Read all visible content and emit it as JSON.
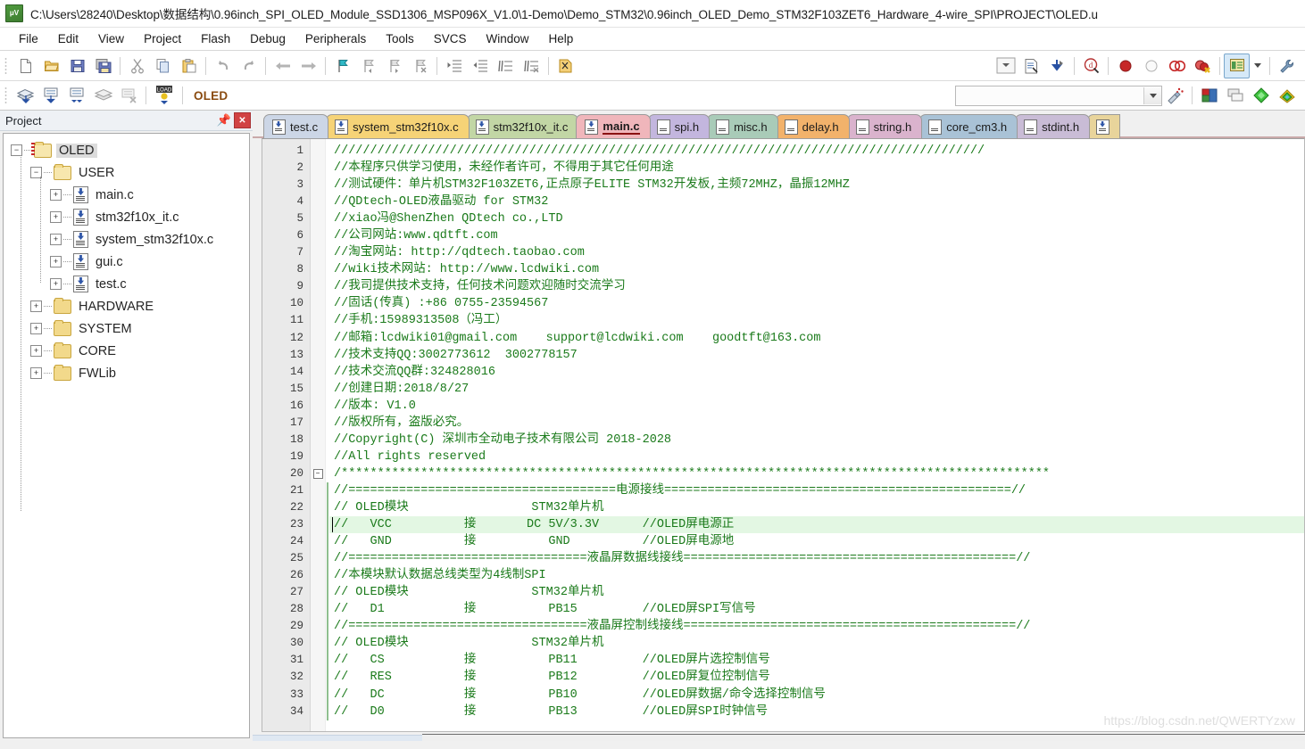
{
  "window": {
    "title": "C:\\Users\\28240\\Desktop\\数据结构\\0.96inch_SPI_OLED_Module_SSD1306_MSP096X_V1.0\\1-Demo\\Demo_STM32\\0.96inch_OLED_Demo_STM32F103ZET6_Hardware_4-wire_SPI\\PROJECT\\OLED.u",
    "app_icon": "uvision-icon",
    "app_icon_glyph": "μV"
  },
  "menubar": {
    "items": [
      {
        "label": "File",
        "name": "menu-file"
      },
      {
        "label": "Edit",
        "name": "menu-edit"
      },
      {
        "label": "View",
        "name": "menu-view"
      },
      {
        "label": "Project",
        "name": "menu-project"
      },
      {
        "label": "Flash",
        "name": "menu-flash"
      },
      {
        "label": "Debug",
        "name": "menu-debug"
      },
      {
        "label": "Peripherals",
        "name": "menu-peripherals"
      },
      {
        "label": "Tools",
        "name": "menu-tools"
      },
      {
        "label": "SVCS",
        "name": "menu-svcs"
      },
      {
        "label": "Window",
        "name": "menu-window"
      },
      {
        "label": "Help",
        "name": "menu-help"
      }
    ]
  },
  "toolbar_main": {
    "groups": [
      [
        "new-file-icon",
        "open-file-icon",
        "save-icon",
        "save-all-icon"
      ],
      [
        "cut-icon",
        "copy-icon",
        "paste-icon"
      ],
      [
        "undo-icon",
        "redo-icon"
      ],
      [
        "navigate-back-icon",
        "navigate-forward-icon"
      ],
      [
        "bookmark-toggle-icon",
        "bookmark-prev-icon",
        "bookmark-next-icon",
        "bookmark-clear-icon"
      ],
      [
        "indent-icon",
        "outdent-icon",
        "comment-icon",
        "uncomment-icon"
      ],
      [
        "find-in-files-icon"
      ]
    ],
    "right_groups": [
      [
        "target-options-dropdown-icon",
        "build-report-icon",
        "download-icon"
      ],
      [
        "start-debug-icon"
      ],
      [
        "insert-breakpoint-icon",
        "disable-breakpoint-icon",
        "disable-all-breakpoints-icon",
        "kill-all-breakpoints-icon"
      ],
      [
        "window-layout-icon"
      ],
      [
        "configure-icon"
      ]
    ]
  },
  "toolbar_build": {
    "buttons": [
      "translate-icon",
      "build-icon",
      "rebuild-icon",
      "batch-build-icon",
      "stop-build-icon",
      "download-load-icon"
    ],
    "download_label": "LOAD",
    "target_name": "OLED",
    "target_placeholder": "",
    "after_buttons": [
      "target-options-icon",
      "manage-project-items-icon",
      "manage-multi-project-icon",
      "pack-installer-icon",
      "manage-runtime-env-icon"
    ]
  },
  "project_panel": {
    "title": "Project",
    "pin_icon": "pin-icon",
    "close_icon": "close-icon",
    "close_glyph": "✕",
    "tree": [
      {
        "label": "OLED",
        "depth": 0,
        "type": "project",
        "expander": "-",
        "selected": true
      },
      {
        "label": "USER",
        "depth": 1,
        "type": "folder",
        "expander": "-",
        "selected": false
      },
      {
        "label": "main.c",
        "depth": 2,
        "type": "cfile",
        "expander": "+",
        "selected": false
      },
      {
        "label": "stm32f10x_it.c",
        "depth": 2,
        "type": "cfile",
        "expander": "+",
        "selected": false
      },
      {
        "label": "system_stm32f10x.c",
        "depth": 2,
        "type": "cfile",
        "expander": "+",
        "selected": false
      },
      {
        "label": "gui.c",
        "depth": 2,
        "type": "cfile",
        "expander": "+",
        "selected": false
      },
      {
        "label": "test.c",
        "depth": 2,
        "type": "cfile",
        "expander": "+",
        "selected": false
      },
      {
        "label": "HARDWARE",
        "depth": 1,
        "type": "folder",
        "expander": "+",
        "selected": false
      },
      {
        "label": "SYSTEM",
        "depth": 1,
        "type": "folder",
        "expander": "+",
        "selected": false
      },
      {
        "label": "CORE",
        "depth": 1,
        "type": "folder",
        "expander": "+",
        "selected": false
      },
      {
        "label": "FWLib",
        "depth": 1,
        "type": "folder",
        "expander": "+",
        "selected": false
      }
    ]
  },
  "editor": {
    "tabs": [
      {
        "label": "test.c",
        "color": "#ccd6e6",
        "type": "c",
        "active": false
      },
      {
        "label": "system_stm32f10x.c",
        "color": "#f6d377",
        "type": "c",
        "active": false
      },
      {
        "label": "stm32f10x_it.c",
        "color": "#c2d6a5",
        "type": "c",
        "active": false
      },
      {
        "label": "main.c",
        "color": "#f0b6bb",
        "type": "c",
        "active": true
      },
      {
        "label": "spi.h",
        "color": "#c3b6de",
        "type": "header",
        "active": false
      },
      {
        "label": "misc.h",
        "color": "#a9cbb8",
        "type": "header",
        "active": false
      },
      {
        "label": "delay.h",
        "color": "#f2b26b",
        "type": "header",
        "active": false
      },
      {
        "label": "string.h",
        "color": "#dab3cd",
        "type": "header",
        "active": false
      },
      {
        "label": "core_cm3.h",
        "color": "#a9c2d6",
        "type": "header",
        "active": false
      },
      {
        "label": "stdint.h",
        "color": "#c9bcd6",
        "type": "header",
        "active": false
      },
      {
        "label": "",
        "color": "#e8d49b",
        "type": "c",
        "active": false
      }
    ],
    "first_line_number": 1,
    "highlighted_line": 23,
    "fold_marker_lines": [
      20
    ],
    "block_bar_lines": [
      21,
      22,
      23,
      24,
      25,
      26,
      27,
      28,
      29,
      30,
      31,
      32,
      33,
      34
    ],
    "lines": [
      "//////////////////////////////////////////////////////////////////////////////////////////",
      "//本程序只供学习使用，未经作者许可，不得用于其它任何用途",
      "//测试硬件：单片机STM32F103ZET6,正点原子ELITE STM32开发板,主频72MHZ，晶振12MHZ",
      "//QDtech-OLED液晶驱动 for STM32",
      "//xiao冯@ShenZhen QDtech co.,LTD",
      "//公司网站:www.qdtft.com",
      "//淘宝网站: http://qdtech.taobao.com",
      "//wiki技术网站: http://www.lcdwiki.com",
      "//我司提供技术支持，任何技术问题欢迎随时交流学习",
      "//固话(传真) :+86 0755-23594567",
      "//手机:15989313508（冯工）",
      "//邮箱:lcdwiki01@gmail.com    support@lcdwiki.com    goodtft@163.com",
      "//技术支持QQ:3002773612  3002778157",
      "//技术交流QQ群:324828016",
      "//创建日期:2018/8/27",
      "//版本: V1.0",
      "//版权所有，盗版必究。",
      "//Copyright(C) 深圳市全动电子技术有限公司 2018-2028",
      "//All rights reserved",
      "/**************************************************************************************************",
      "//=====================================电源接线================================================//",
      "// OLED模块                 STM32单片机",
      "//   VCC          接       DC 5V/3.3V      //OLED屏电源正",
      "//   GND          接          GND          //OLED屏电源地",
      "//=================================液晶屏数据线接线==============================================//",
      "//本模块默认数据总线类型为4线制SPI",
      "// OLED模块                 STM32单片机",
      "//   D1           接          PB15         //OLED屏SPI写信号",
      "//=================================液晶屏控制线接线==============================================//",
      "// OLED模块                 STM32单片机",
      "//   CS           接          PB11         //OLED屏片选控制信号",
      "//   RES          接          PB12         //OLED屏复位控制信号",
      "//   DC           接          PB10         //OLED屏数据/命令选择控制信号",
      "//   D0           接          PB13         //OLED屏SPI时钟信号"
    ],
    "watermark": "https://blog.csdn.net/QWERTYzxw"
  },
  "colors": {
    "comment_green": "#1a7a1a",
    "highlight_row": "#e3f7e3",
    "target_label": "#8a4b10",
    "active_tab_underline": "#8b1111"
  }
}
